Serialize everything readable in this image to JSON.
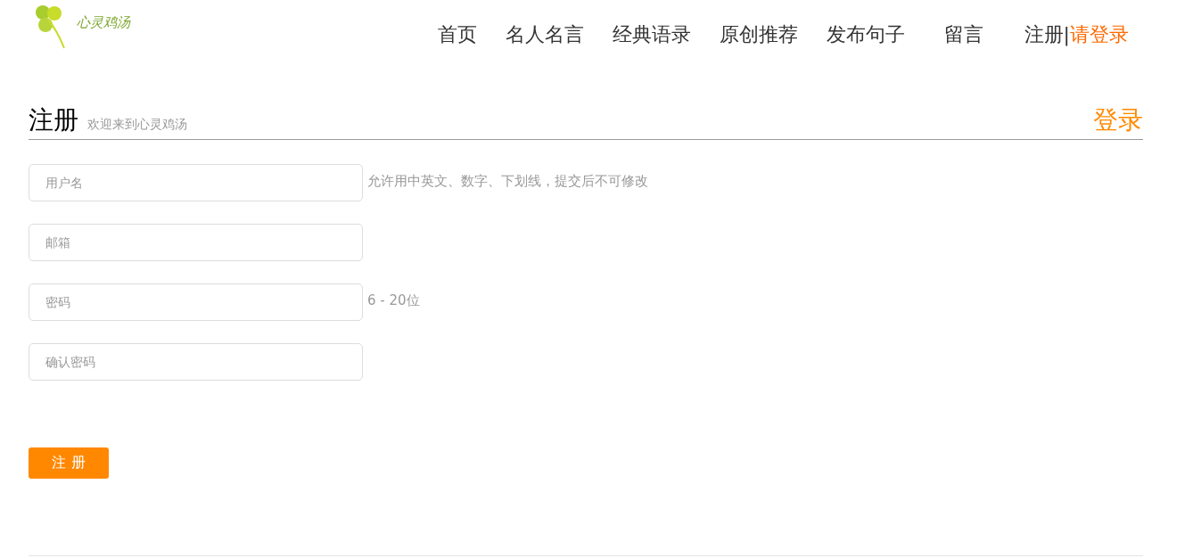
{
  "logo": {
    "text": "心灵鸡汤"
  },
  "nav": [
    {
      "label": "首页"
    },
    {
      "label": "名人名言"
    },
    {
      "label": "经典语录"
    },
    {
      "label": "原创推荐"
    },
    {
      "label": "发布句子"
    },
    {
      "label": "留言"
    }
  ],
  "account": {
    "register": "注册",
    "separator": "|",
    "login": "请登录"
  },
  "heading": {
    "title": "注册",
    "subtitle": "欢迎来到心灵鸡汤",
    "login_link": "登录"
  },
  "fields": [
    {
      "placeholder": "用户名",
      "hint": "允许用中英文、数字、下划线，提交后不可修改"
    },
    {
      "placeholder": "邮箱"
    },
    {
      "placeholder": "密码",
      "hint": "6 - 20位"
    },
    {
      "placeholder": "确认密码"
    }
  ],
  "submit": "注 册"
}
